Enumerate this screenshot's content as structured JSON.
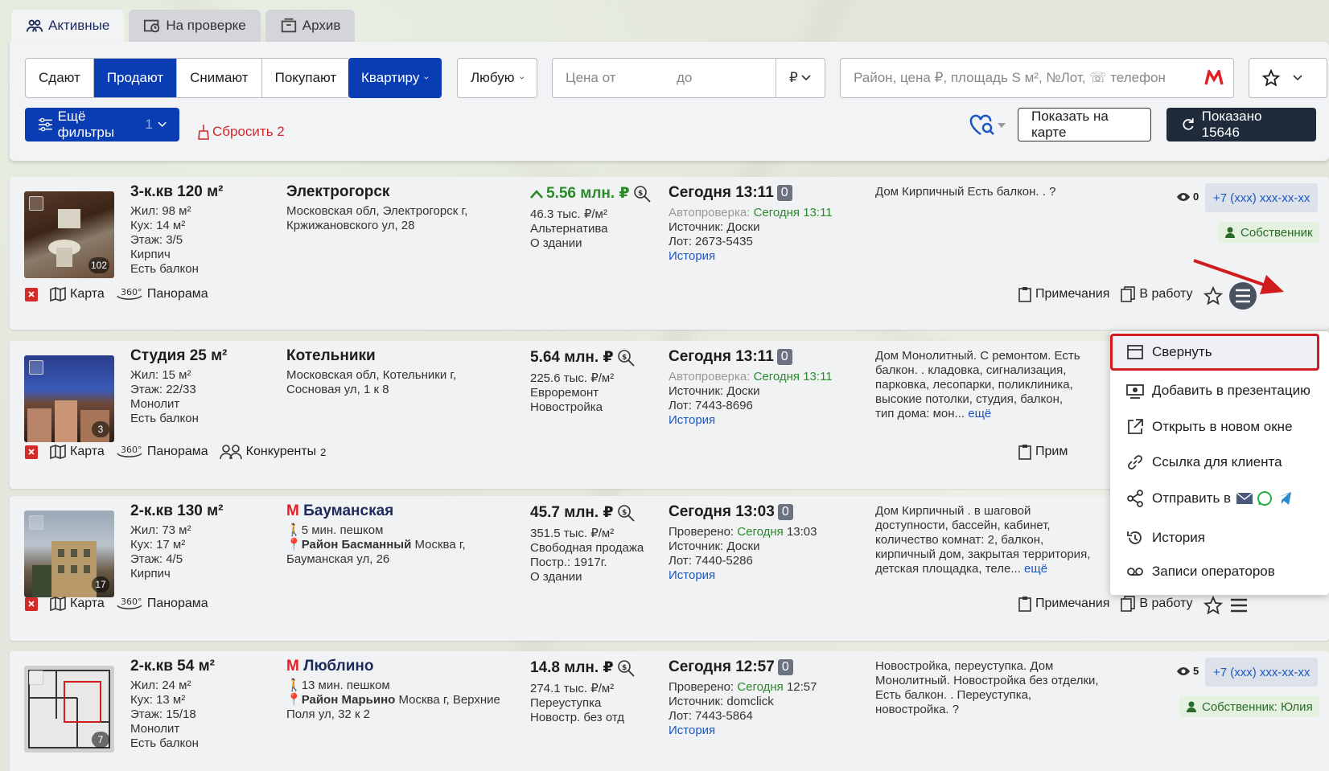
{
  "tabs": [
    {
      "label": "Активные"
    },
    {
      "label": "На проверке"
    },
    {
      "label": "Архив"
    }
  ],
  "filters": {
    "deal_types": [
      "Сдают",
      "Продают",
      "Снимают",
      "Покупают"
    ],
    "object_type": "Квартиру",
    "rooms": "Любую",
    "price_from_placeholder": "Цена от",
    "price_to_placeholder": "до",
    "currency": "₽",
    "search_placeholder": "Район, цена ₽, площадь S м², №Лот, ☏ телефон",
    "more_filters": "Ещё фильтры",
    "more_filters_count": "1",
    "reset": "Сбросить 2",
    "show_on_map": "Показать на карте",
    "shown": "Показано 15646"
  },
  "listings": [
    {
      "title": "3-к.кв 120 м²",
      "details": [
        "Жил: 98 м²",
        "Кух: 14 м²",
        "Этаж: 3/5",
        "Кирпич",
        "Есть балкон"
      ],
      "location_title": "Электрогорск",
      "location_lines": [
        "Московская обл, Электрогорск г,",
        "Кржижановского ул, 28"
      ],
      "price": "5.56 млн. ₽",
      "price_lines": [
        "46.3 тыс. ₽/м²",
        "Альтернатива",
        "О здании"
      ],
      "date": "Сегодня 13:11",
      "badge": "0",
      "check_label": "Автопроверка:",
      "check_value": "Сегодня 13:11",
      "source": "Источник: Доски",
      "lot": "Лот: 2673-5435",
      "history": "История",
      "description": "Дом Кирпичный Есть балкон. . ?",
      "photo_count": "102",
      "views": "0",
      "phone": "+7 (xxx) xxx-xx-xx",
      "owner": "Собственник"
    },
    {
      "title": "Студия 25 м²",
      "details": [
        "Жил: 15 м²",
        "Этаж: 22/33",
        "Монолит",
        "Есть балкон"
      ],
      "location_title": "Котельники",
      "location_lines": [
        "Московская обл, Котельники г,",
        "Сосновая ул, 1 к 8"
      ],
      "price": "5.64 млн. ₽",
      "price_lines": [
        "225.6 тыс. ₽/м²",
        "Евроремонт",
        "Новостройка"
      ],
      "date": "Сегодня 13:11",
      "badge": "0",
      "check_label": "Автопроверка:",
      "check_value": "Сегодня 13:11",
      "source": "Источник: Доски",
      "lot": "Лот: 7443-8696",
      "history": "История",
      "description": "Дом Монолитный. С ремонтом. Есть балкон. . кладовка, сигнализация, парковка, лесопарки, поликлиника, высокие потолки, студия, балкон, тип дома: мон...",
      "more": "ещё",
      "photo_count": "3",
      "competitors": "Конкуренты",
      "competitors_count": "2"
    },
    {
      "title": "2-к.кв 130 м²",
      "details": [
        "Жил: 73 м²",
        "Кух: 17 м²",
        "Этаж: 4/5",
        "Кирпич"
      ],
      "metro": "Бауманская",
      "walk": "5 мин. пешком",
      "district": "Район Басманный",
      "location_lines": [
        "Москва г,",
        "Бауманская ул, 26"
      ],
      "price": "45.7 млн. ₽",
      "price_lines": [
        "351.5 тыс. ₽/м²",
        "Свободная продажа",
        "Постр.: 1917г.",
        "О здании"
      ],
      "date": "Сегодня 13:03",
      "badge": "0",
      "check_label": "Проверено:",
      "check_value": "Сегодня",
      "check_time": "13:03",
      "source": "Источник: Доски",
      "lot": "Лот: 7440-5286",
      "history": "История",
      "description": "Дом Кирпичный . в шаговой доступности, бассейн, кабинет, количество комнат: 2, балкон, кирпичный дом, закрытая территория, детская площадка, теле...",
      "more": "ещё",
      "photo_count": "17"
    },
    {
      "title": "2-к.кв 54 м²",
      "details": [
        "Жил: 24 м²",
        "Кух: 13 м²",
        "Этаж: 15/18",
        "Монолит",
        "Есть балкон"
      ],
      "metro": "Люблино",
      "walk": "13 мин. пешком",
      "district": "Район Марьино",
      "location_lines": [
        "Москва г, Верхние",
        "Поля ул, 32 к 2"
      ],
      "price": "14.8 млн. ₽",
      "price_lines": [
        "274.1 тыс. ₽/м²",
        "Переуступка",
        "Новостр. без отд"
      ],
      "date": "Сегодня 12:57",
      "badge": "0",
      "check_label": "Проверено:",
      "check_value": "Сегодня",
      "check_time": "12:57",
      "source": "Источник: domclick",
      "lot": "Лот: 7443-5864",
      "history": "История",
      "description": "Новостройка, переуступка. Дом Монолитный. Новостройка без отделки, Есть балкон. . Переуступка, новостройка. ?",
      "photo_count": "7",
      "views": "5",
      "phone": "+7 (xxx) xxx-xx-xx",
      "owner": "Собственник: Юлия"
    }
  ],
  "actions": {
    "map": "Карта",
    "panorama": "Панорама",
    "notes": "Примечания",
    "to_work": "В работу",
    "notes_short": "Прим"
  },
  "menu": {
    "items": [
      {
        "label": "Свернуть"
      },
      {
        "label": "Добавить в презентацию"
      },
      {
        "label": "Открыть в новом окне"
      },
      {
        "label": "Ссылка для клиента"
      },
      {
        "label": "Отправить в"
      },
      {
        "label": "История"
      },
      {
        "label": "Записи операторов"
      }
    ]
  },
  "colors": {
    "primary": "#0a3db3",
    "dark": "#1f2a3a",
    "danger": "#d42a2a",
    "metro": "#e31e24",
    "link": "#1a56c4",
    "highlight": "#d01c1c"
  }
}
